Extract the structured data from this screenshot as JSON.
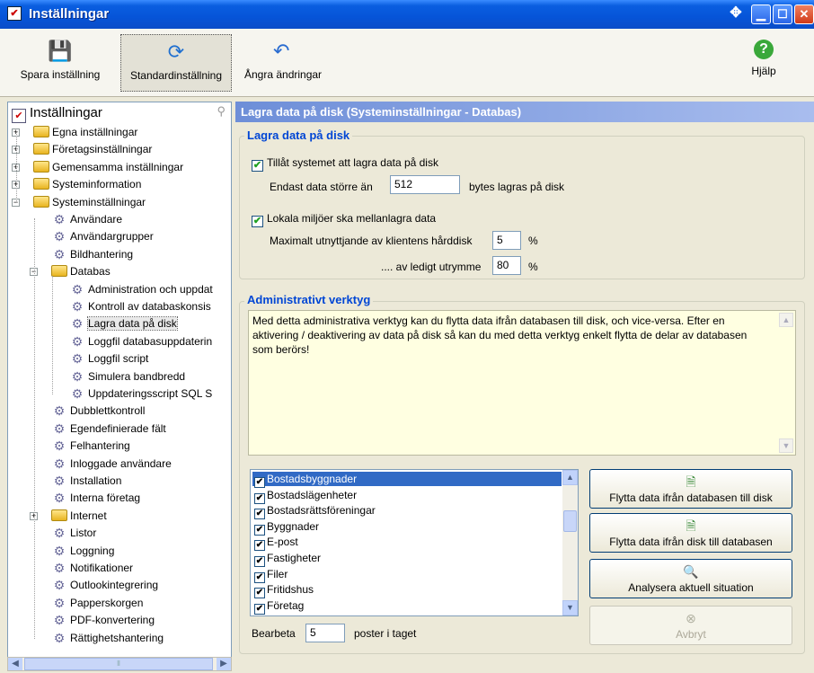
{
  "window": {
    "title": "Inställningar"
  },
  "toolbar": {
    "save": "Spara inställning",
    "standard": "Standardinställning",
    "undo": "Ångra ändringar",
    "help": "Hjälp"
  },
  "tree": {
    "root": "Inställningar",
    "items": [
      "Egna inställningar",
      "Företagsinställningar",
      "Gemensamma inställningar",
      "Systeminformation",
      "Systeminställningar",
      "Användare",
      "Användargrupper",
      "Bildhantering",
      "Databas",
      "Administration och uppdat",
      "Kontroll av databaskonsis",
      "Lagra data på disk",
      "Loggfil databasuppdaterin",
      "Loggfil script",
      "Simulera bandbredd",
      "Uppdateringsscript SQL S",
      "Dubblettkontroll",
      "Egendefinierade fält",
      "Felhantering",
      "Inloggade användare",
      "Installation",
      "Interna företag",
      "Internet",
      "Listor",
      "Loggning",
      "Notifikationer",
      "Outlookintegrering",
      "Papperskorgen",
      "PDF-konvertering",
      "Rättighetshantering"
    ]
  },
  "panel": {
    "title": "Lagra data på disk (Systeminställningar - Databas)"
  },
  "storage": {
    "legend": "Lagra data på disk",
    "allow_label": "Tillåt systemet att lagra data på disk",
    "min_label": "Endast data större än",
    "min_value": "512",
    "min_suffix": "bytes lagras på disk",
    "cache_label": "Lokala miljöer ska mellanlagra data",
    "max_label": "Maximalt utnyttjande av klientens hårddisk",
    "max_value": "5",
    "pct": "%",
    "free_label": ".... av ledigt utrymme",
    "free_value": "80"
  },
  "admin": {
    "legend": "Administrativt verktyg",
    "description": "Med detta administrativa verktyg kan du flytta data ifrån databasen till disk, och vice-versa. Efter en aktivering / deaktivering av data på disk så kan du med detta verktyg enkelt flytta de delar av databasen som berörs!",
    "list": [
      "Bostadsbyggnader",
      "Bostadslägenheter",
      "Bostadsrättsföreningar",
      "Byggnader",
      "E-post",
      "Fastigheter",
      "Filer",
      "Fritidshus",
      "Företag"
    ],
    "batch_label": "Bearbeta",
    "batch_value": "5",
    "batch_suffix": "poster i taget",
    "btn_to_disk": "Flytta data ifrån databasen till disk",
    "btn_to_db": "Flytta data ifrån disk till databasen",
    "btn_analyze": "Analysera aktuell situation",
    "btn_cancel": "Avbryt"
  },
  "colors": {
    "titlebar": "#0a5ee0",
    "panel_header": "#6d8ed8",
    "legend": "#0046d5",
    "selection": "#316ac5"
  }
}
